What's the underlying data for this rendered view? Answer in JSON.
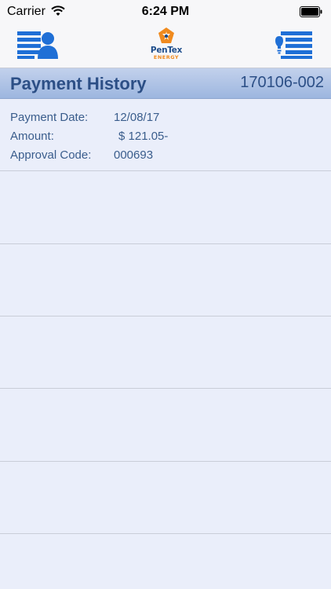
{
  "status_bar": {
    "carrier": "Carrier",
    "time": "6:24 PM"
  },
  "nav": {
    "left_icon": "account-list-icon",
    "logo_text": "PenTex",
    "logo_subtext": "ENERGY",
    "right_icon": "payment-list-icon"
  },
  "header": {
    "title": "Payment History",
    "account_number": "170106-002"
  },
  "payment": {
    "date_label": "Payment Date:",
    "date_value": "12/08/17",
    "amount_label": "Amount:",
    "amount_value": "$ 121.05-",
    "approval_label": "Approval Code:",
    "approval_value": "000693"
  },
  "colors": {
    "accent": "#2c4f86",
    "background": "#eaeefa",
    "icon_blue": "#1f6fd6",
    "logo_orange": "#f08a1e"
  }
}
